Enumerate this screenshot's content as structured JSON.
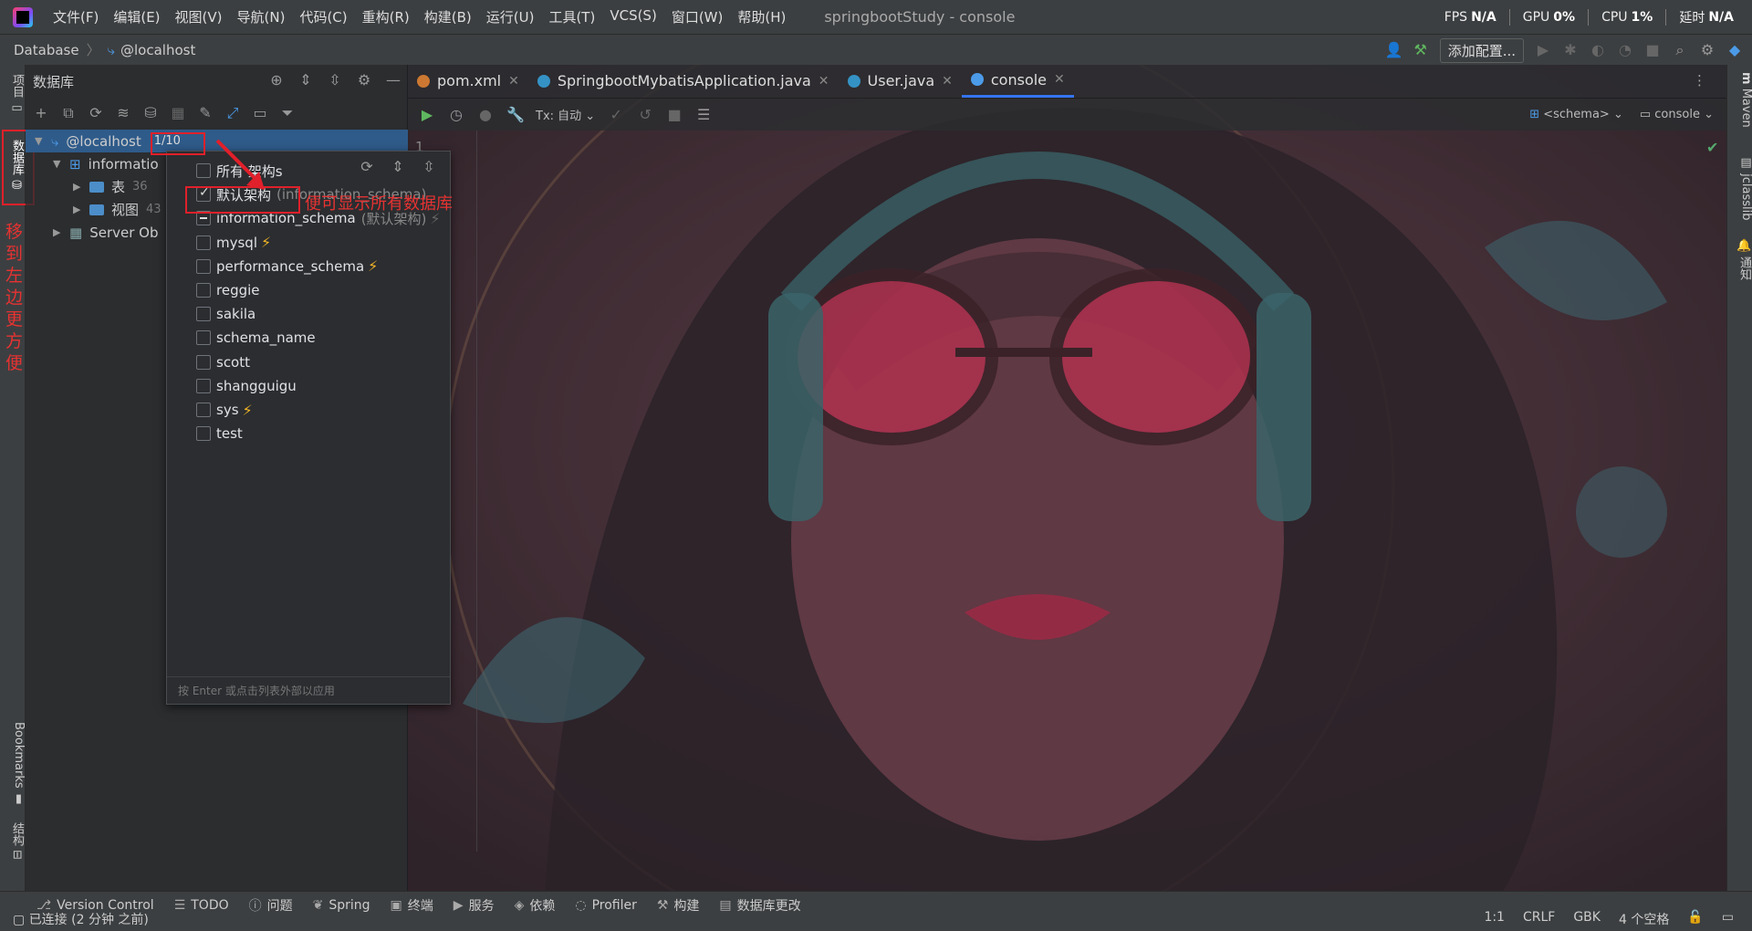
{
  "menubar": {
    "items": [
      "文件(F)",
      "编辑(E)",
      "视图(V)",
      "导航(N)",
      "代码(C)",
      "重构(R)",
      "构建(B)",
      "运行(U)",
      "工具(T)",
      "VCS(S)",
      "窗口(W)",
      "帮助(H)"
    ],
    "window_title": "springbootStudy - console",
    "perf": {
      "fps_label": "FPS",
      "fps_value": "N/A",
      "gpu_label": "GPU",
      "gpu_value": "0%",
      "cpu_label": "CPU",
      "cpu_value": "1%",
      "latency_label": "延时",
      "latency_value": "N/A"
    }
  },
  "navbar": {
    "crumbs": [
      "Database",
      "@localhost"
    ],
    "add_config": "添加配置..."
  },
  "left_stripe": {
    "project": "项目",
    "database": "数据库",
    "bookmarks": "Bookmarks",
    "structure": "结构"
  },
  "right_stripe": {
    "maven": "Maven",
    "jclasslib": "jclasslib",
    "notifications": "通知"
  },
  "db_panel": {
    "title": "数据库",
    "tree": {
      "root_label": "@localhost",
      "root_count": "1/10",
      "schema": "informatio",
      "tables": "表",
      "tables_count": "36",
      "views": "视图",
      "views_count": "43",
      "server_objects": "Server Ob"
    }
  },
  "schema_popup": {
    "options": [
      {
        "label": "所有 架构s",
        "checked": false
      },
      {
        "label": "默认架构",
        "hint": "(information_schema)",
        "checked": true
      },
      {
        "label": "information_schema",
        "hint": "(默认架构)",
        "partial": true,
        "bolt": "dim"
      },
      {
        "label": "mysql",
        "bolt": "on"
      },
      {
        "label": "performance_schema",
        "bolt": "on"
      },
      {
        "label": "reggie"
      },
      {
        "label": "sakila"
      },
      {
        "label": "schema_name"
      },
      {
        "label": "scott"
      },
      {
        "label": "shangguigu"
      },
      {
        "label": "sys",
        "bolt": "on"
      },
      {
        "label": "test"
      }
    ],
    "footer": "按 Enter 或点击列表外部以应用"
  },
  "annotations": {
    "show_all": "便可显示所有数据库",
    "move_left": [
      "移",
      "到",
      "左",
      "边",
      "更",
      "方",
      "便"
    ]
  },
  "tabs": [
    {
      "label": "pom.xml",
      "color": "#cc7832"
    },
    {
      "label": "SpringbootMybatisApplication.java",
      "color": "#3592c4"
    },
    {
      "label": "User.java",
      "color": "#3592c4"
    },
    {
      "label": "console",
      "color": "#4c9be8",
      "active": true
    }
  ],
  "editor_toolbar": {
    "tx": "Tx: 自动",
    "schema": "<schema>",
    "console": "console"
  },
  "editor": {
    "line_number": "1"
  },
  "tool_windows": [
    "Version Control",
    "TODO",
    "问题",
    "Spring",
    "终端",
    "服务",
    "依赖",
    "Profiler",
    "构建",
    "数据库更改"
  ],
  "status": {
    "left": "已连接 (2 分钟 之前)",
    "position": "1:1",
    "line_sep": "CRLF",
    "encoding": "GBK",
    "indent": "4 个空格"
  }
}
